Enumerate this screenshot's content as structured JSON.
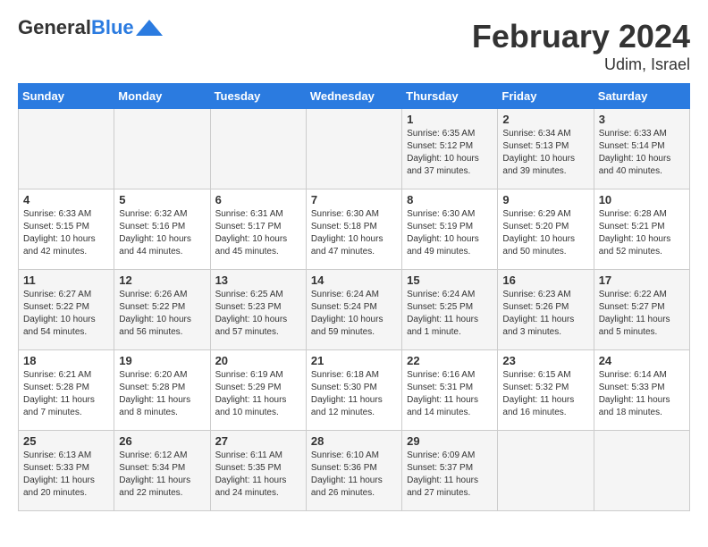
{
  "header": {
    "logo_general": "General",
    "logo_blue": "Blue",
    "title": "February 2024",
    "subtitle": "Udim, Israel"
  },
  "days_of_week": [
    "Sunday",
    "Monday",
    "Tuesday",
    "Wednesday",
    "Thursday",
    "Friday",
    "Saturday"
  ],
  "weeks": [
    [
      {
        "day": "",
        "content": ""
      },
      {
        "day": "",
        "content": ""
      },
      {
        "day": "",
        "content": ""
      },
      {
        "day": "",
        "content": ""
      },
      {
        "day": "1",
        "content": "Sunrise: 6:35 AM\nSunset: 5:12 PM\nDaylight: 10 hours and 37 minutes."
      },
      {
        "day": "2",
        "content": "Sunrise: 6:34 AM\nSunset: 5:13 PM\nDaylight: 10 hours and 39 minutes."
      },
      {
        "day": "3",
        "content": "Sunrise: 6:33 AM\nSunset: 5:14 PM\nDaylight: 10 hours and 40 minutes."
      }
    ],
    [
      {
        "day": "4",
        "content": "Sunrise: 6:33 AM\nSunset: 5:15 PM\nDaylight: 10 hours and 42 minutes."
      },
      {
        "day": "5",
        "content": "Sunrise: 6:32 AM\nSunset: 5:16 PM\nDaylight: 10 hours and 44 minutes."
      },
      {
        "day": "6",
        "content": "Sunrise: 6:31 AM\nSunset: 5:17 PM\nDaylight: 10 hours and 45 minutes."
      },
      {
        "day": "7",
        "content": "Sunrise: 6:30 AM\nSunset: 5:18 PM\nDaylight: 10 hours and 47 minutes."
      },
      {
        "day": "8",
        "content": "Sunrise: 6:30 AM\nSunset: 5:19 PM\nDaylight: 10 hours and 49 minutes."
      },
      {
        "day": "9",
        "content": "Sunrise: 6:29 AM\nSunset: 5:20 PM\nDaylight: 10 hours and 50 minutes."
      },
      {
        "day": "10",
        "content": "Sunrise: 6:28 AM\nSunset: 5:21 PM\nDaylight: 10 hours and 52 minutes."
      }
    ],
    [
      {
        "day": "11",
        "content": "Sunrise: 6:27 AM\nSunset: 5:22 PM\nDaylight: 10 hours and 54 minutes."
      },
      {
        "day": "12",
        "content": "Sunrise: 6:26 AM\nSunset: 5:22 PM\nDaylight: 10 hours and 56 minutes."
      },
      {
        "day": "13",
        "content": "Sunrise: 6:25 AM\nSunset: 5:23 PM\nDaylight: 10 hours and 57 minutes."
      },
      {
        "day": "14",
        "content": "Sunrise: 6:24 AM\nSunset: 5:24 PM\nDaylight: 10 hours and 59 minutes."
      },
      {
        "day": "15",
        "content": "Sunrise: 6:24 AM\nSunset: 5:25 PM\nDaylight: 11 hours and 1 minute."
      },
      {
        "day": "16",
        "content": "Sunrise: 6:23 AM\nSunset: 5:26 PM\nDaylight: 11 hours and 3 minutes."
      },
      {
        "day": "17",
        "content": "Sunrise: 6:22 AM\nSunset: 5:27 PM\nDaylight: 11 hours and 5 minutes."
      }
    ],
    [
      {
        "day": "18",
        "content": "Sunrise: 6:21 AM\nSunset: 5:28 PM\nDaylight: 11 hours and 7 minutes."
      },
      {
        "day": "19",
        "content": "Sunrise: 6:20 AM\nSunset: 5:28 PM\nDaylight: 11 hours and 8 minutes."
      },
      {
        "day": "20",
        "content": "Sunrise: 6:19 AM\nSunset: 5:29 PM\nDaylight: 11 hours and 10 minutes."
      },
      {
        "day": "21",
        "content": "Sunrise: 6:18 AM\nSunset: 5:30 PM\nDaylight: 11 hours and 12 minutes."
      },
      {
        "day": "22",
        "content": "Sunrise: 6:16 AM\nSunset: 5:31 PM\nDaylight: 11 hours and 14 minutes."
      },
      {
        "day": "23",
        "content": "Sunrise: 6:15 AM\nSunset: 5:32 PM\nDaylight: 11 hours and 16 minutes."
      },
      {
        "day": "24",
        "content": "Sunrise: 6:14 AM\nSunset: 5:33 PM\nDaylight: 11 hours and 18 minutes."
      }
    ],
    [
      {
        "day": "25",
        "content": "Sunrise: 6:13 AM\nSunset: 5:33 PM\nDaylight: 11 hours and 20 minutes."
      },
      {
        "day": "26",
        "content": "Sunrise: 6:12 AM\nSunset: 5:34 PM\nDaylight: 11 hours and 22 minutes."
      },
      {
        "day": "27",
        "content": "Sunrise: 6:11 AM\nSunset: 5:35 PM\nDaylight: 11 hours and 24 minutes."
      },
      {
        "day": "28",
        "content": "Sunrise: 6:10 AM\nSunset: 5:36 PM\nDaylight: 11 hours and 26 minutes."
      },
      {
        "day": "29",
        "content": "Sunrise: 6:09 AM\nSunset: 5:37 PM\nDaylight: 11 hours and 27 minutes."
      },
      {
        "day": "",
        "content": ""
      },
      {
        "day": "",
        "content": ""
      }
    ]
  ]
}
